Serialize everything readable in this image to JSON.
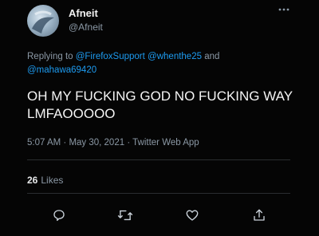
{
  "author": {
    "display_name": "Afneit",
    "handle": "@Afneit"
  },
  "menu_icon": "more-icon",
  "reply": {
    "prefix": "Replying to ",
    "mentions": [
      "@FirefoxSupport",
      "@whenthe25",
      "@mahawa69420"
    ],
    "conjunction": " and "
  },
  "tweet": {
    "text": "OH MY FUCKING GOD NO FUCKING WAY LMFAOOOOO"
  },
  "meta": {
    "time": "5:07 AM",
    "date": "May 30, 2021",
    "client": "Twitter Web App",
    "separator": " · "
  },
  "stats": {
    "likes_count": "26",
    "likes_label": "Likes"
  },
  "actions": [
    "reply-icon",
    "retweet-icon",
    "like-icon",
    "share-icon"
  ],
  "colors": {
    "background": "#050505",
    "mention": "#1d9bf0",
    "secondary_text": "#8b98a5",
    "primary_text": "#f5f5f5"
  }
}
